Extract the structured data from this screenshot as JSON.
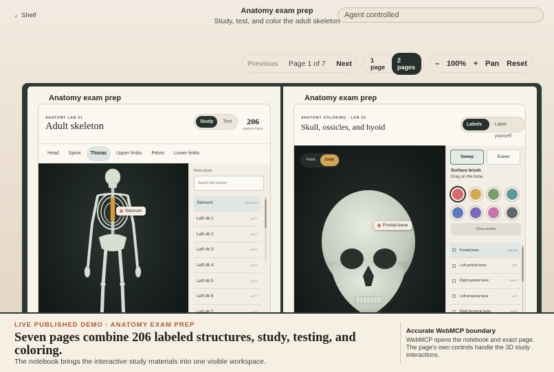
{
  "header": {
    "back_label": "Shelf",
    "title": "Anatomy exam prep",
    "subtitle": "Study, test, and color the adult skeleton",
    "agent_status": "Agent controlled"
  },
  "toolbar": {
    "previous": "Previous",
    "page_info": "Page 1 of 7",
    "next": "Next",
    "one_page": "1 page",
    "two_pages": "2 pages",
    "zoom_out": "–",
    "zoom_level": "100%",
    "zoom_in": "+",
    "pan": "Pan",
    "reset": "Reset"
  },
  "left_page": {
    "heading": "Anatomy exam prep",
    "lab_tag": "ANATOMY LAB 01",
    "lab_title": "Adult skeleton",
    "mode_study": "Study",
    "mode_test": "Test",
    "count": "206",
    "count_label": "IDENTITIES",
    "region_tabs": [
      "Head",
      "Spine",
      "Thorax",
      "Upper limbs",
      "Pelvis",
      "Lower limbs"
    ],
    "active_tab": "Thorax",
    "hover_label": "Sternum",
    "find_label": "Find a bone",
    "search_placeholder": "Search this section",
    "bones": [
      {
        "name": "Sternum",
        "side": "MIDLINE"
      },
      {
        "name": "Left rib 1",
        "side": "LEFT"
      },
      {
        "name": "Left rib 2",
        "side": "LEFT"
      },
      {
        "name": "Left rib 3",
        "side": "LEFT"
      },
      {
        "name": "Left rib 4",
        "side": "LEFT"
      },
      {
        "name": "Left rib 5",
        "side": "LEFT"
      },
      {
        "name": "Left rib 6",
        "side": "LEFT"
      },
      {
        "name": "Left rib 7",
        "side": "LEFT"
      }
    ]
  },
  "right_page": {
    "heading": "Anatomy exam prep",
    "lab_tag": "ANATOMY COLORING · LAB 02",
    "lab_title": "Skull, ossicles, and hyoid",
    "labels_on": "Labels on",
    "label_yourself": "Label yourself",
    "paint": "Paint",
    "orbit": "Orbit",
    "hover_label": "Frontal bone",
    "sweep": "Sweep",
    "eraser": "Eraser",
    "brush_title": "Surface brush",
    "brush_hint": "Drag on the bone.",
    "swatches": [
      "#d9686a",
      "#d5a851",
      "#7b9a6e",
      "#5c9a9a",
      "#5e78c2",
      "#7c68b8",
      "#c774a8",
      "#616670"
    ],
    "clear": "Clear section",
    "structures": [
      {
        "name": "Frontal bone",
        "side": "MIDLINE"
      },
      {
        "name": "Left parietal bone",
        "side": "LEFT"
      },
      {
        "name": "Right parietal bone",
        "side": "RIGHT"
      },
      {
        "name": "Left temporal bone",
        "side": "LEFT"
      },
      {
        "name": "Right temporal bone",
        "side": "RIGHT"
      }
    ]
  },
  "footer": {
    "kicker": "LIVE PUBLISHED DEMO · ANATOMY EXAM PREP",
    "headline": "Seven pages combine 206 labeled structures, study, testing, and coloring.",
    "sub": "The notebook brings the interactive study materials into one visible workspace.",
    "side_title": "Accurate WebMCP boundary",
    "side_body": "WebMCP opens the notebook and exact page. The page's own controls handle the 3D study interactions."
  },
  "colors": {
    "accent_dark": "#24312c",
    "footer_kicker": "#b05a32",
    "hover_dot": "#e0704f"
  }
}
